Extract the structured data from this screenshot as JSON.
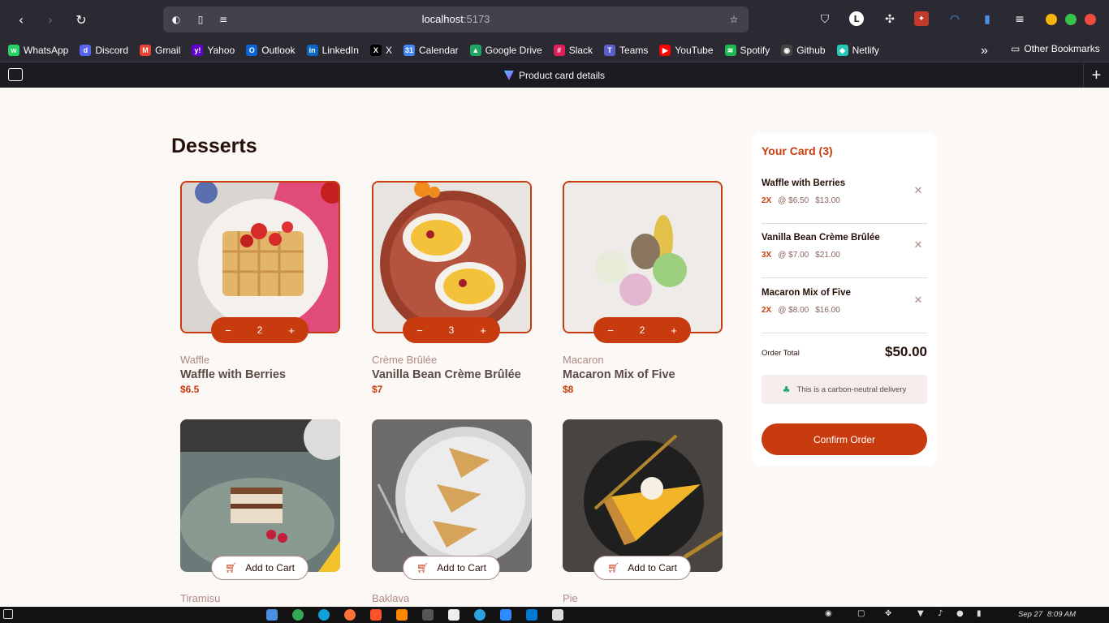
{
  "browser": {
    "url_host": "localhost",
    "url_port": ":5173",
    "tab_title": "Product card details",
    "profile_initial": "L",
    "bookmarks": [
      {
        "label": "WhatsApp",
        "color": "#25d366",
        "glyph": "w"
      },
      {
        "label": "Discord",
        "color": "#5865f2",
        "glyph": "d"
      },
      {
        "label": "Gmail",
        "color": "#ea4335",
        "glyph": "M"
      },
      {
        "label": "Yahoo",
        "color": "#6001d2",
        "glyph": "y!"
      },
      {
        "label": "Outlook",
        "color": "#0a64d8",
        "glyph": "O"
      },
      {
        "label": "LinkedIn",
        "color": "#0a66c2",
        "glyph": "in"
      },
      {
        "label": "X",
        "color": "#000000",
        "glyph": "X"
      },
      {
        "label": "Calendar",
        "color": "#4285f4",
        "glyph": "31"
      },
      {
        "label": "Google Drive",
        "color": "#1fa463",
        "glyph": "▲"
      },
      {
        "label": "Slack",
        "color": "#e01e5a",
        "glyph": "#"
      },
      {
        "label": "Teams",
        "color": "#5b5fc7",
        "glyph": "T"
      },
      {
        "label": "YouTube",
        "color": "#ff0000",
        "glyph": "▶"
      },
      {
        "label": "Spotify",
        "color": "#1db954",
        "glyph": "≋"
      },
      {
        "label": "Github",
        "color": "#444444",
        "glyph": "◉"
      },
      {
        "label": "Netlify",
        "color": "#25c7b7",
        "glyph": "◆"
      }
    ],
    "other_bookmarks": "Other Bookmarks"
  },
  "page": {
    "title": "Desserts"
  },
  "products": [
    {
      "category": "Waffle",
      "name": "Waffle with Berries",
      "price": "$6.5",
      "in_cart": true,
      "qty": "2"
    },
    {
      "category": "Crème Brûlée",
      "name": "Vanilla Bean Crème Brûlée",
      "price": "$7",
      "in_cart": true,
      "qty": "3"
    },
    {
      "category": "Macaron",
      "name": "Macaron Mix of Five",
      "price": "$8",
      "in_cart": true,
      "qty": "2"
    },
    {
      "category": "Tiramisu",
      "name": "",
      "price": "",
      "in_cart": false,
      "add_label": "Add to Cart"
    },
    {
      "category": "Baklava",
      "name": "",
      "price": "",
      "in_cart": false,
      "add_label": "Add to Cart"
    },
    {
      "category": "Pie",
      "name": "",
      "price": "",
      "in_cart": false,
      "add_label": "Add to Cart"
    }
  ],
  "cart": {
    "title": "Your Card (3)",
    "items": [
      {
        "name": "Waffle with Berries",
        "qty": "2X",
        "unit": "@ $6.50",
        "total": "$13.00"
      },
      {
        "name": "Vanilla Bean Crème Brûlée",
        "qty": "3X",
        "unit": "@ $7.00",
        "total": "$21.00"
      },
      {
        "name": "Macaron Mix of Five",
        "qty": "2X",
        "unit": "@ $8.00",
        "total": "$16.00"
      }
    ],
    "order_total_label": "Order Total",
    "order_total": "$50.00",
    "carbon_text": "This is a carbon-neutral delivery",
    "confirm_label": "Confirm Order"
  },
  "taskbar": {
    "date": "Sep 27",
    "time": "8:09 AM"
  },
  "colors": {
    "accent": "#c73b0f",
    "background": "#fcf8f6",
    "text_dark": "#260f08"
  }
}
